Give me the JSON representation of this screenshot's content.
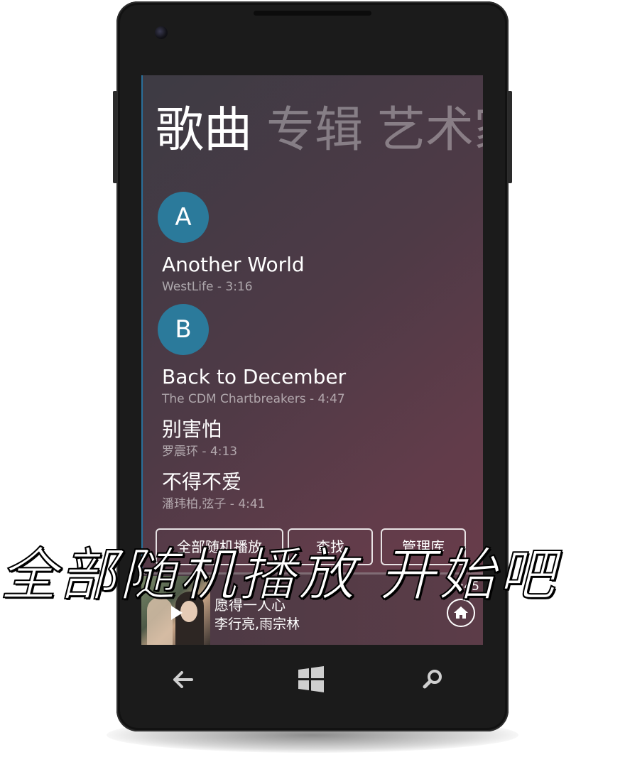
{
  "pivot": {
    "headers": [
      "歌曲",
      "专辑",
      "艺术家"
    ]
  },
  "groups": [
    {
      "letter": "A"
    },
    {
      "letter": "B"
    }
  ],
  "songs": [
    {
      "title": "Another World",
      "subtitle": "WestLife - 3:16"
    },
    {
      "title": "Back to December",
      "subtitle": "The CDM Chartbreakers - 4:47"
    },
    {
      "title": "别害怕",
      "subtitle": "罗震环 - 4:13"
    },
    {
      "title": "不得不爱",
      "subtitle": "潘玮柏,弦子 - 4:41"
    }
  ],
  "commands": {
    "shuffle_all": "全部随机播放",
    "find": "查找",
    "manage_library": "管理库"
  },
  "now_playing": {
    "title": "愿得一人心",
    "artist": "李行亮,雨宗林",
    "time": "1:45"
  },
  "overlay": {
    "caption": "全部随机播放 开始吧"
  },
  "icons": {
    "play": "play-icon",
    "home": "home-icon",
    "back": "back-arrow-icon",
    "start": "windows-start-icon",
    "search": "search-icon"
  },
  "colors": {
    "accent": "#2b7a9b",
    "background_start": "#3d3b44",
    "background_end": "#6a3d4b"
  }
}
